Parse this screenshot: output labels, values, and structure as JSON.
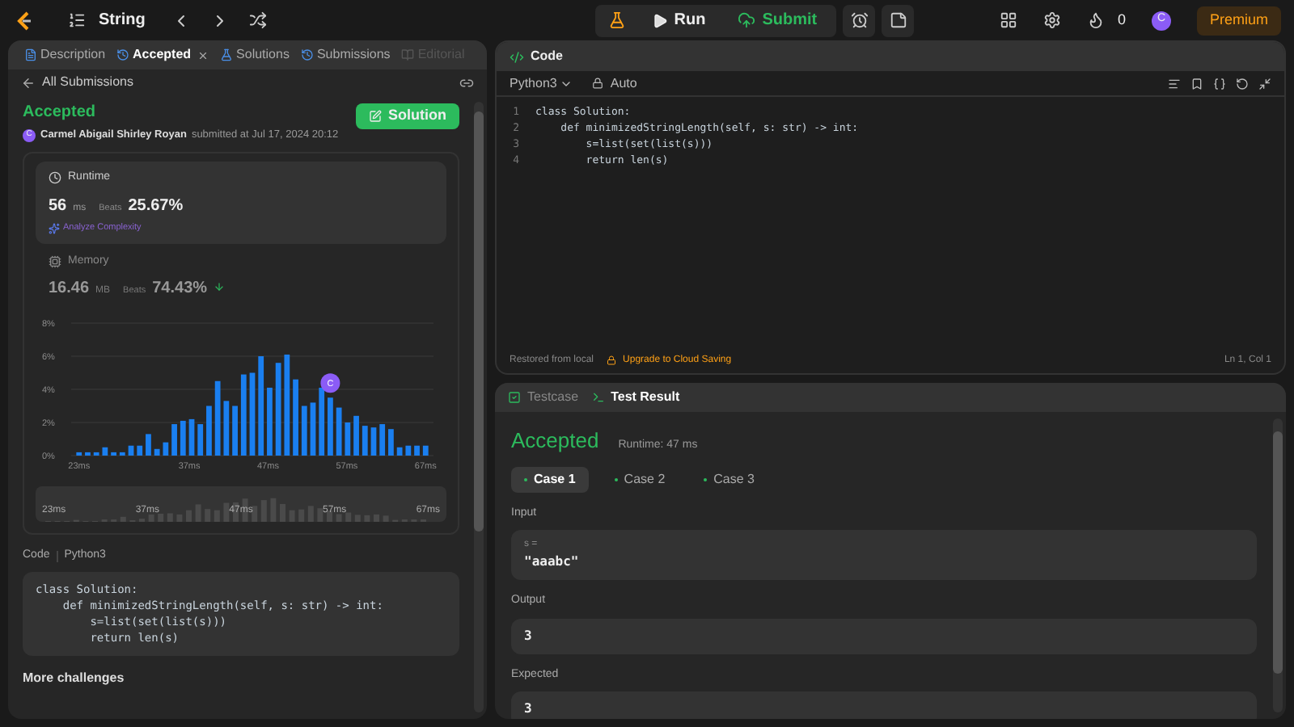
{
  "topbar": {
    "problem_list": "String",
    "run": "Run",
    "submit": "Submit",
    "streak": "0",
    "avatar": "C",
    "premium": "Premium"
  },
  "left_tabs": [
    {
      "label": "Description",
      "selected": false,
      "disabled": false
    },
    {
      "label": "Accepted",
      "selected": true,
      "disabled": false
    },
    {
      "label": "Solutions",
      "selected": false,
      "disabled": false
    },
    {
      "label": "Submissions",
      "selected": false,
      "disabled": false
    },
    {
      "label": "Editorial",
      "selected": false,
      "disabled": true
    }
  ],
  "back_link": "All Submissions",
  "submission": {
    "status": "Accepted",
    "avatar": "C",
    "user": "Carmel Abigail Shirley Royan",
    "submitted": "submitted at Jul 17, 2024 20:12",
    "solution_button": "Solution"
  },
  "runtime": {
    "title": "Runtime",
    "value": "56",
    "unit": "ms",
    "beats_label": "Beats",
    "beats": "25.67%",
    "analyze": "Analyze Complexity"
  },
  "memory": {
    "title": "Memory",
    "value": "16.46",
    "unit": "MB",
    "beats_label": "Beats",
    "beats": "74.43%"
  },
  "chart_marker": "C",
  "chart_data": {
    "type": "bar",
    "grid": true,
    "xlim": [
      22,
      68
    ],
    "x": [
      23,
      24.1,
      25.2,
      26.3,
      27.4,
      28.5,
      29.6,
      30.7,
      31.8,
      32.9,
      34,
      35.1,
      36.2,
      37.3,
      38.4,
      39.5,
      40.6,
      41.7,
      42.8,
      43.9,
      45,
      46.1,
      47.2,
      48.3,
      49.4,
      50.5,
      51.6,
      52.7,
      53.8,
      54.9,
      56,
      57.1,
      58.2,
      59.3,
      60.4,
      61.5,
      62.6,
      63.7,
      64.8,
      65.9,
      67
    ],
    "values": [
      0.2,
      0.2,
      0.2,
      0.5,
      0.2,
      0.2,
      0.6,
      0.6,
      1.3,
      0.4,
      0.8,
      1.9,
      2.1,
      2.2,
      1.9,
      3.0,
      4.5,
      3.3,
      3.0,
      4.9,
      5.0,
      6.0,
      4.1,
      5.6,
      6.1,
      4.6,
      3.0,
      3.2,
      4.1,
      3.5,
      2.9,
      2.0,
      2.4,
      1.8,
      1.7,
      1.9,
      1.6,
      0.5,
      0.6,
      0.6,
      0.6
    ],
    "ylim": [
      0,
      8
    ],
    "yticks": [
      {
        "value": 0,
        "label": "0%"
      },
      {
        "value": 2,
        "label": "2%"
      },
      {
        "value": 4,
        "label": "4%"
      },
      {
        "value": 6,
        "label": "6%"
      },
      {
        "value": 8,
        "label": "8%"
      }
    ],
    "xticks": [
      {
        "value": 23,
        "label": "23ms"
      },
      {
        "value": 37,
        "label": "37ms"
      },
      {
        "value": 47,
        "label": "47ms"
      },
      {
        "value": 57,
        "label": "57ms"
      },
      {
        "value": 67,
        "label": "67ms"
      }
    ]
  },
  "minimap_labels": [
    "23ms",
    "37ms",
    "47ms",
    "57ms",
    "67ms"
  ],
  "code_header": {
    "title": "Code",
    "language": "Python3"
  },
  "submitted_code": [
    "class Solution:",
    "    def minimizedStringLength(self, s: str) -> int:",
    "        s=list(set(list(s)))",
    "        return len(s)"
  ],
  "more_challenges": "More challenges",
  "editor": {
    "title": "Code",
    "language": "Python3",
    "mode": "Auto",
    "lines": [
      "class Solution:",
      "    def minimizedStringLength(self, s: str) -> int:",
      "        s=list(set(list(s)))",
      "        return len(s)"
    ],
    "line_numbers": [
      "1",
      "2",
      "3",
      "4"
    ],
    "restored": "Restored from local",
    "upgrade": "Upgrade to Cloud Saving",
    "cursor": "Ln 1, Col 1"
  },
  "bottom_tabs": [
    {
      "label": "Testcase",
      "selected": false
    },
    {
      "label": "Test Result",
      "selected": true
    }
  ],
  "result": {
    "status": "Accepted",
    "runtime": "Runtime: 47 ms",
    "cases": [
      {
        "label": "Case 1",
        "selected": true
      },
      {
        "label": "Case 2",
        "selected": false
      },
      {
        "label": "Case 3",
        "selected": false
      }
    ],
    "input_label": "Input",
    "input_var": "s =",
    "input_value": "\"aaabc\"",
    "output_label": "Output",
    "output_value": "3",
    "expected_label": "Expected",
    "expected_value": "3"
  }
}
